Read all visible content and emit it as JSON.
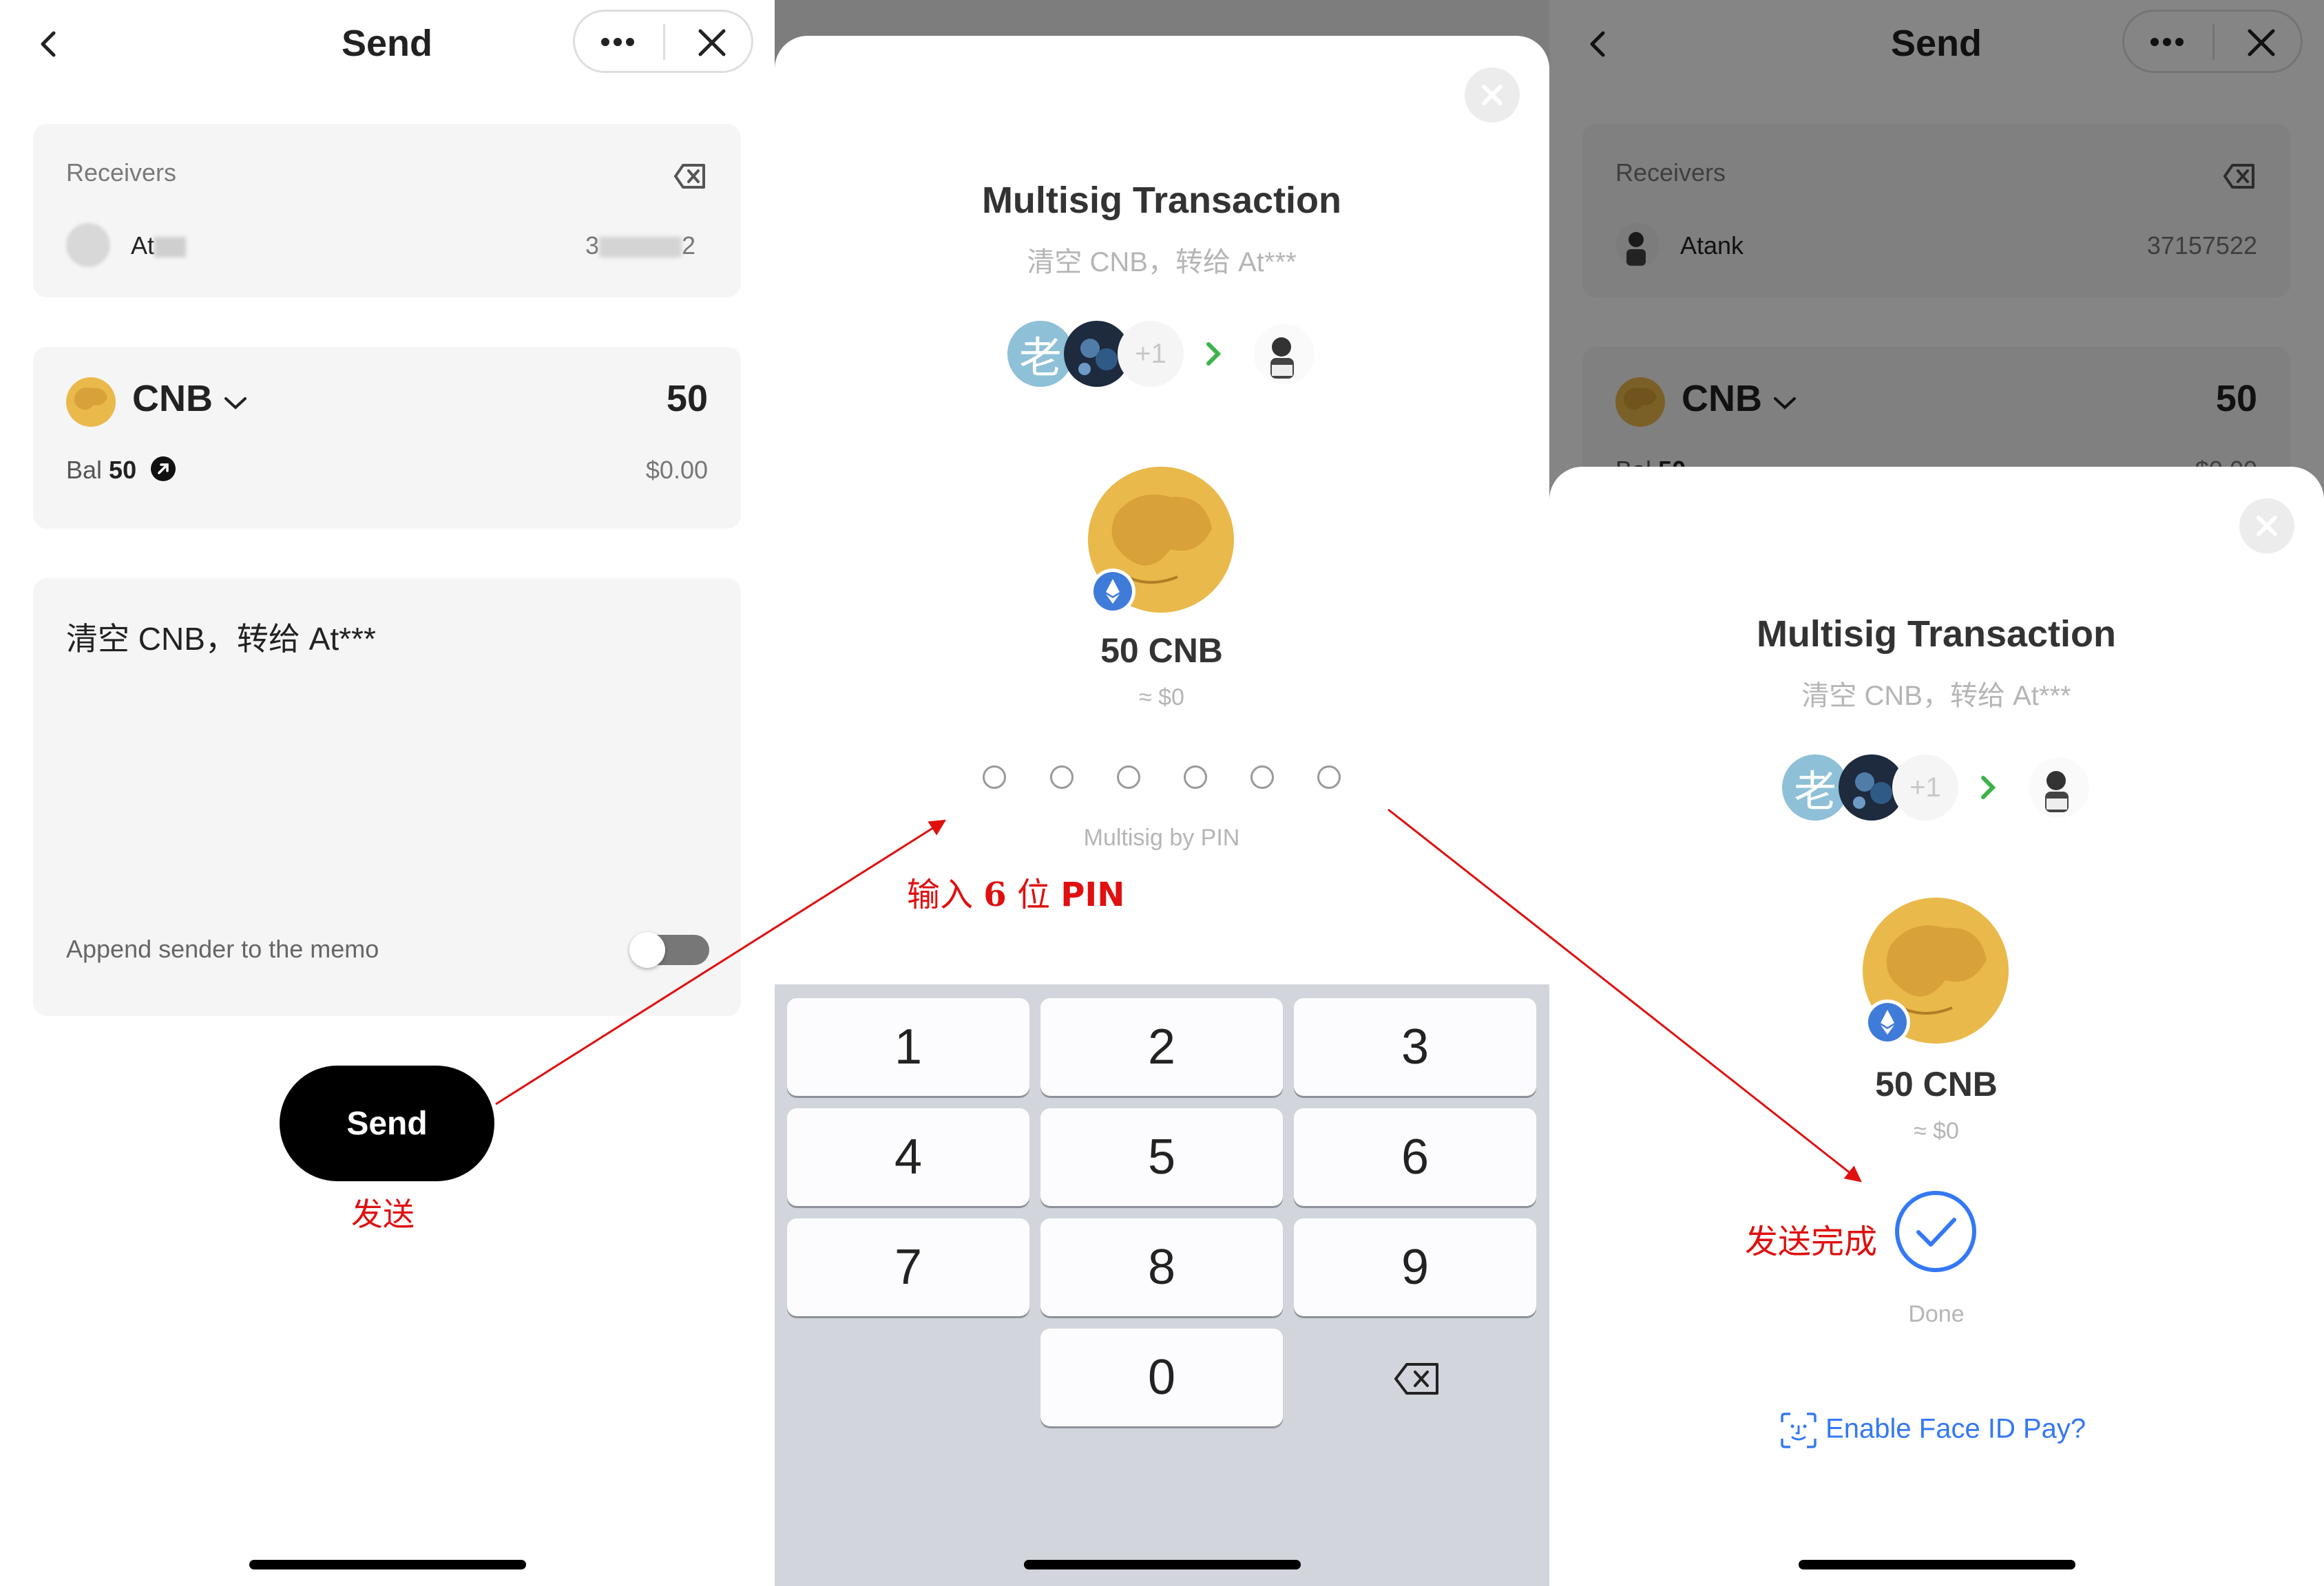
{
  "screen1": {
    "title": "Send",
    "receivers_label": "Receivers",
    "receiver_name": "At",
    "receiver_id_prefix": "3",
    "receiver_id_suffix": "2",
    "asset": "CNB",
    "amount": "50",
    "balance_label": "Bal",
    "balance_value": "50",
    "fiat_value": "$0.00",
    "memo": "清空 CNB，转给 At***",
    "append_sender_label": "Append sender to the memo",
    "append_sender_enabled": false,
    "send_button": "Send",
    "annotation": "发送"
  },
  "screen2": {
    "title": "Multisig Transaction",
    "subtitle": "清空 CNB，转给 At***",
    "signer_avatar_char": "老",
    "signer_extra": "+1",
    "amount_text": "50 CNB",
    "fiat_text": "≈ $0",
    "pin_hint": "Multisig by PIN",
    "annotation_prefix": "输入",
    "annotation_num": "6",
    "annotation_mid": "位",
    "annotation_pin": "PIN",
    "keys": [
      "1",
      "2",
      "3",
      "4",
      "5",
      "6",
      "7",
      "8",
      "9",
      "0"
    ]
  },
  "screen3": {
    "title": "Send",
    "receivers_label": "Receivers",
    "receiver_name": "Atank",
    "receiver_id": "37157522",
    "asset": "CNB",
    "amount": "50",
    "balance_label": "Bal",
    "balance_value": "50",
    "fiat_value": "$0.00",
    "sheet_title": "Multisig Transaction",
    "sheet_subtitle": "清空 CNB，转给 At***",
    "signer_avatar_char": "老",
    "signer_extra": "+1",
    "amount_text": "50 CNB",
    "fiat_text": "≈ $0",
    "done_label": "Done",
    "annotation": "发送完成",
    "face_id_link": "Enable Face ID Pay?"
  },
  "colors": {
    "annotation_red": "#e01010",
    "link_blue": "#3478f6",
    "coin_gold": "#eab94b",
    "arrow_green": "#3cb34a",
    "eth_blue": "#3f7bd9"
  }
}
